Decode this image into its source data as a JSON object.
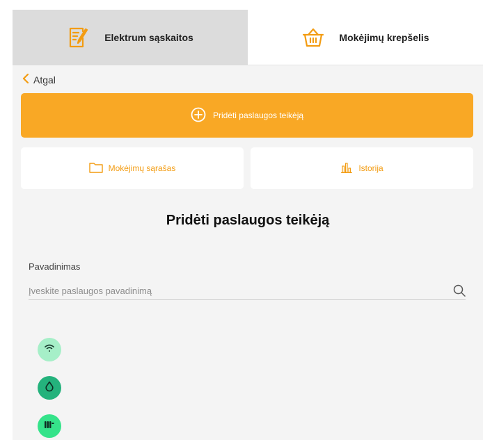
{
  "tabs": [
    {
      "label": "Elektrum sąskaitos",
      "icon": "invoice-edit-icon",
      "active": true
    },
    {
      "label": "Mokėjimų krepšelis",
      "icon": "basket-icon",
      "active": false
    }
  ],
  "back": {
    "label": "Atgal",
    "icon": "chevron-left-icon"
  },
  "add_button": {
    "label": "Pridėti paslaugos teikėją",
    "icon": "plus-circle-icon"
  },
  "nav_cards": [
    {
      "label": "Mokėjimų sąrašas",
      "icon": "folder-icon"
    },
    {
      "label": "Istorija",
      "icon": "bar-chart-icon"
    }
  ],
  "page_title": "Pridėti paslaugos teikėją",
  "search": {
    "label": "Pavadinimas",
    "placeholder": "Įveskite paslaugos pavadinimą",
    "value": "",
    "icon": "search-icon"
  },
  "categories": [
    {
      "icon": "wifi-icon",
      "color": "#a6efc8"
    },
    {
      "icon": "water-drop-icon",
      "color": "#24b27c"
    },
    {
      "icon": "radiator-icon",
      "color": "#35e38a"
    }
  ],
  "colors": {
    "accent": "#f9a825",
    "accent_text": "#f39c12"
  }
}
